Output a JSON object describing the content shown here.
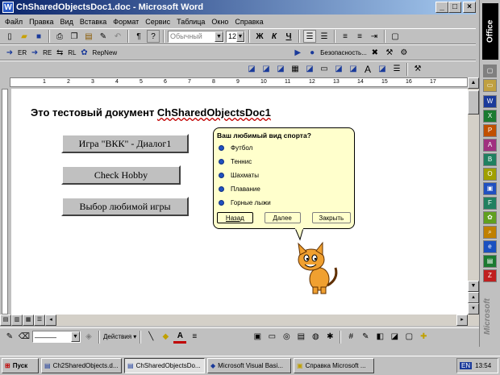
{
  "window": {
    "title": "ChSharedObjectsDoc1.doc - Microsoft Word",
    "icon": "word-icon",
    "min": "_",
    "max": "□",
    "close": "×"
  },
  "menu": [
    "Файл",
    "Правка",
    "Вид",
    "Вставка",
    "Формат",
    "Сервис",
    "Таблица",
    "Окно",
    "Справка"
  ],
  "toolbar": {
    "style": "Обычный",
    "size": "12",
    "bold": "Ж",
    "italic": "К",
    "underline": "Ч",
    "pilcrow": "¶",
    "help": "?"
  },
  "toolbar2": {
    "er": "ER",
    "re": "RE",
    "rl": "RL",
    "repnew": "RepNew",
    "security": "Безопасность..."
  },
  "ruler": {
    "marks": [
      "1",
      "2",
      "3",
      "4",
      "5",
      "6",
      "7",
      "8",
      "9",
      "10",
      "11",
      "12",
      "13",
      "14",
      "15",
      "16",
      "17"
    ]
  },
  "document": {
    "title_prefix": "Это тестовый документ ",
    "title_name": "ChSharedObjectsDoc1",
    "buttons": [
      "Игра \"ВКК\" - Диалог1",
      "Check Hobby",
      "Выбор любимой игры"
    ]
  },
  "assistant": {
    "question": "Ваш любимый вид спорта?",
    "options": [
      "Футбол",
      "Теннис",
      "Шахматы",
      "Плавание",
      "Горные лыжи"
    ],
    "back": "Назад",
    "next": "Далее",
    "close": "Закрыть",
    "character": "cat-assistant"
  },
  "officebar": {
    "label": "Office",
    "brand": "Microsoft"
  },
  "drawing": {
    "actions": "Действия"
  },
  "taskbar": {
    "start": "Пуск",
    "tasks": [
      "Ch2SharedObjects.d...",
      "ChSharedObjectsDo...",
      "Microsoft Visual Basi...",
      "Справка Microsoft ..."
    ],
    "lang": "EN",
    "time": "13:54"
  }
}
